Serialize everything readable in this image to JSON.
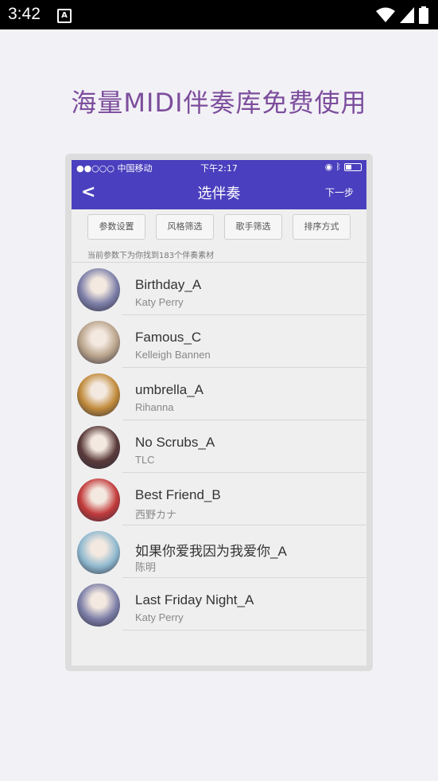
{
  "statusbar": {
    "time": "3:42",
    "a_icon": "A"
  },
  "headline": "海量MIDI伴奏库免费使用",
  "ios": {
    "carrier": "●●○○○ 中国移动",
    "time": "下午2:17"
  },
  "nav": {
    "back": "<",
    "title": "选伴奏",
    "next": "下一步"
  },
  "filters": [
    "参数设置",
    "风格筛选",
    "歌手筛选",
    "排序方式"
  ],
  "result_note": "当前参数下为你找到183个伴奏素材",
  "songs": [
    {
      "title": "Birthday_A",
      "artist": "Katy Perry",
      "color": "#7d7fa8"
    },
    {
      "title": "Famous_C",
      "artist": "Kelleigh Bannen",
      "color": "#b8a28a"
    },
    {
      "title": "umbrella_A",
      "artist": "Rihanna",
      "color": "#c08a3a"
    },
    {
      "title": "No Scrubs_A",
      "artist": "TLC",
      "color": "#5a3a3a"
    },
    {
      "title": "Best Friend_B",
      "artist": " 西野カナ",
      "color": "#c23b3b"
    },
    {
      "title": "如果你爱我因为我爱你_A",
      "artist": "陈明",
      "color": "#8fb9cf"
    },
    {
      "title": "Last Friday Night_A",
      "artist": "Katy Perry",
      "color": "#7d7fa8"
    }
  ]
}
